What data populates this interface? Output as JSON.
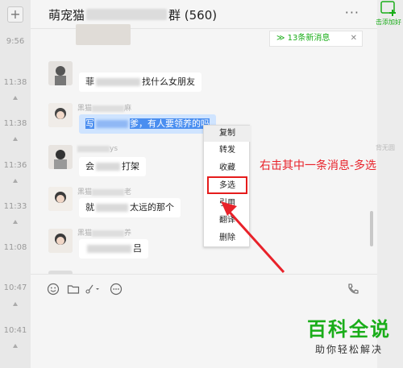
{
  "chat": {
    "title_prefix": "萌宠猫",
    "title_suffix": "群 (560)",
    "more_label": "···",
    "new_messages": {
      "label": "13条新消息",
      "chevron": "≫",
      "close": "✕"
    }
  },
  "session_list": {
    "add_label": "+",
    "times": [
      "9:56",
      "11:38",
      "11:38",
      "11:36",
      "11:33",
      "11:08",
      "10:47",
      "10:41"
    ]
  },
  "messages": [
    {
      "sender": "",
      "text_start": "菲",
      "text_end": "找什么女朋友"
    },
    {
      "sender": "黑猫",
      "sender_end": "麻",
      "text_start": "写",
      "text_end": "爹，有人要领养的吗"
    },
    {
      "sender": "",
      "sender_end": "ys",
      "text_start": "会",
      "text_end": "打架"
    },
    {
      "sender": "黑猫",
      "sender_end": "老",
      "text_start": "就",
      "text_end": "太远的那个"
    },
    {
      "sender": "黑猫",
      "sender_end": "养",
      "text_start": "",
      "text_end": "吕"
    }
  ],
  "context_menu": {
    "items": [
      "复制",
      "转发",
      "收藏",
      "多选",
      "引用",
      "翻译",
      "删除"
    ],
    "highlighted": "多选",
    "hover": "复制"
  },
  "annotation": {
    "text": "右击其中一条消息-多选",
    "color": "#e8222a"
  },
  "right_strip": {
    "add_label": "击添加好",
    "cut_text": "背无圆"
  },
  "watermark": {
    "main": "百科全说",
    "sub": "助你轻松解决"
  },
  "colors": {
    "accent": "#1aad19",
    "selection": "#4a8ef0",
    "highlight_box": "#e51c1c"
  },
  "icons": [
    "plus-icon",
    "emoji-icon",
    "folder-icon",
    "chat-bubble-icon",
    "phone-icon",
    "add-contact-icon"
  ]
}
